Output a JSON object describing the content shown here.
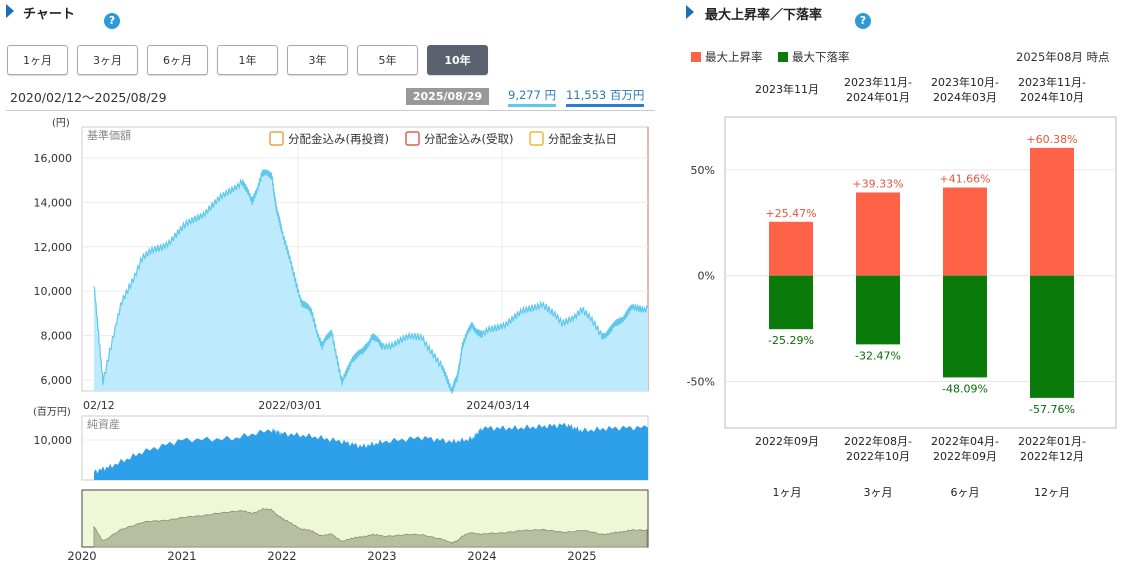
{
  "chart_section": {
    "title": "チャート",
    "help": "?",
    "period_buttons": [
      "1ヶ月",
      "3ヶ月",
      "6ヶ月",
      "1年",
      "3年",
      "5年",
      "10年"
    ],
    "active_period": "10年",
    "date_range": "2020/02/12～2025/08/29",
    "as_of_badge": "2025/08/29",
    "nav_value": "9,277 円",
    "net_assets_value": "11,553 百万円",
    "colors": {
      "nav_fill": "#bdeafc",
      "nav_line": "#5fc8ec",
      "assets_fill": "#2ea0ea",
      "nav_underline": "#5fc8ec",
      "assets_underline": "#2b7fd0",
      "navigator_bg": "#eef8d6",
      "navigator_fill": "#b8bfa0"
    }
  },
  "chart_data": [
    {
      "type": "area",
      "title": "基準価額",
      "ylabel": "(円)",
      "ylim": [
        5500,
        17400
      ],
      "y_ticks": [
        "16,000",
        "14,000",
        "12,000",
        "10,000",
        "8,000",
        "6,000"
      ],
      "x_tick_labels": [
        "02/12",
        "2022/03/01",
        "2024/03/14"
      ],
      "legend": [
        "分配金込み(再投資)",
        "分配金込み(受取)",
        "分配金支払日"
      ],
      "legend_colors": [
        "#f0a040",
        "#e0604a",
        "#f0b830"
      ],
      "x": [
        2020.12,
        2020.21,
        2020.4,
        2020.6,
        2020.8,
        2021.0,
        2021.2,
        2021.4,
        2021.6,
        2021.7,
        2021.8,
        2021.9,
        2021.95,
        2022.0,
        2022.1,
        2022.2,
        2022.3,
        2022.4,
        2022.5,
        2022.6,
        2022.7,
        2022.8,
        2022.9,
        2023.0,
        2023.2,
        2023.4,
        2023.6,
        2023.7,
        2023.75,
        2023.8,
        2023.9,
        2024.0,
        2024.2,
        2024.4,
        2024.6,
        2024.8,
        2025.0,
        2025.2,
        2025.3,
        2025.4,
        2025.5,
        2025.66
      ],
      "values": [
        10200,
        6000,
        9500,
        11500,
        12000,
        12800,
        13500,
        14200,
        15000,
        14000,
        15300,
        15200,
        13500,
        12800,
        11000,
        9500,
        9000,
        7500,
        8200,
        5800,
        7000,
        7200,
        8000,
        7500,
        7800,
        8000,
        6500,
        5600,
        6000,
        7500,
        8500,
        8000,
        8500,
        9000,
        9500,
        8500,
        9200,
        8000,
        8300,
        8800,
        9200,
        9277
      ]
    },
    {
      "type": "area",
      "title": "純資産",
      "ylabel": "(百万円)",
      "y_ticks": [
        "10,000"
      ],
      "ylim": [
        5000,
        13000
      ],
      "x": [
        2020.12,
        2020.3,
        2020.6,
        2021.0,
        2021.5,
        2021.9,
        2022.0,
        2022.3,
        2022.6,
        2022.8,
        2023.0,
        2023.4,
        2023.7,
        2023.9,
        2024.0,
        2024.3,
        2024.6,
        2024.85,
        2025.0,
        2025.3,
        2025.66
      ],
      "values": [
        6000,
        6800,
        8500,
        10000,
        10200,
        11300,
        10800,
        10500,
        9800,
        9200,
        9800,
        10300,
        9800,
        10200,
        11500,
        11500,
        11700,
        11900,
        11200,
        11500,
        11553
      ]
    },
    {
      "type": "area",
      "title": "",
      "x_tick_labels": [
        "2020",
        "2021",
        "2022",
        "2023",
        "2024",
        "2025"
      ],
      "xlim": [
        2020.0,
        2025.66
      ]
    },
    {
      "type": "bar",
      "title": "最大上昇率／下落率",
      "categories": [
        "1ヶ月",
        "3ヶ月",
        "6ヶ月",
        "12ヶ月"
      ],
      "series": [
        {
          "name": "最大上昇率",
          "values": [
            25.47,
            39.33,
            41.66,
            60.38
          ],
          "labels": [
            "+25.47%",
            "+39.33%",
            "+41.66%",
            "+60.38%"
          ],
          "color": "#ff6347",
          "periods": [
            [
              "2023年11月"
            ],
            [
              "2023年11月-",
              "2024年01月"
            ],
            [
              "2023年10月-",
              "2024年03月"
            ],
            [
              "2023年11月-",
              "2024年10月"
            ]
          ]
        },
        {
          "name": "最大下落率",
          "values": [
            -25.29,
            -32.47,
            -48.09,
            -57.76
          ],
          "labels": [
            "-25.29%",
            "-32.47%",
            "-48.09%",
            "-57.76%"
          ],
          "color": "#0a7a0a",
          "periods": [
            [
              "2022年09月"
            ],
            [
              "2022年08月-",
              "2022年10月"
            ],
            [
              "2022年04月-",
              "2022年09月"
            ],
            [
              "2022年01月-",
              "2022年12月"
            ]
          ]
        }
      ],
      "y_ticks": [
        "50%",
        "0%",
        "-50%"
      ],
      "ylim": [
        -72,
        75
      ],
      "as_of": "2025年08月 時点"
    }
  ],
  "dd_section": {
    "title": "最大上昇率／下落率",
    "help": "?"
  }
}
